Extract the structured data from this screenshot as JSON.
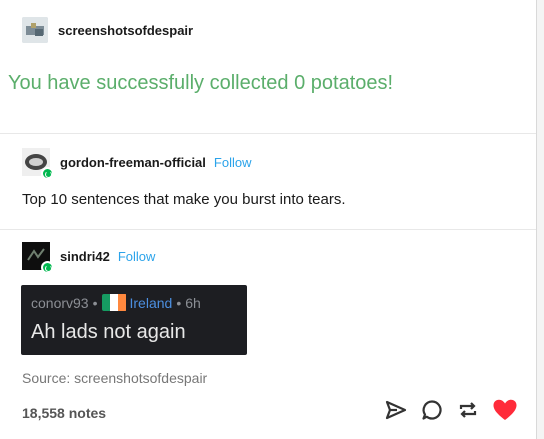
{
  "post1": {
    "username": "screenshotsofdespair",
    "big_text": "You have successfully collected 0 potatoes!"
  },
  "post2": {
    "username": "gordon-freeman-official",
    "follow_label": "Follow",
    "text": "Top 10 sentences that make you burst into tears."
  },
  "post3": {
    "username": "sindri42",
    "follow_label": "Follow",
    "embed": {
      "user": "conorv93",
      "sep1": "•",
      "country": "Ireland",
      "sep2": "•",
      "age": "6h",
      "message": "Ah lads not again"
    },
    "source": "Source: screenshotsofdespair"
  },
  "footer": {
    "notes": "18,558 notes",
    "icons": [
      "share-icon",
      "reply-icon",
      "reblog-icon",
      "like-icon"
    ],
    "like_color": "#ff2b3a"
  },
  "colors": {
    "green_text": "#5bae6b",
    "follow_blue": "#2ba3ea",
    "ireland_green": "#169b62",
    "ireland_white": "#ffffff",
    "ireland_orange": "#ff883e"
  }
}
